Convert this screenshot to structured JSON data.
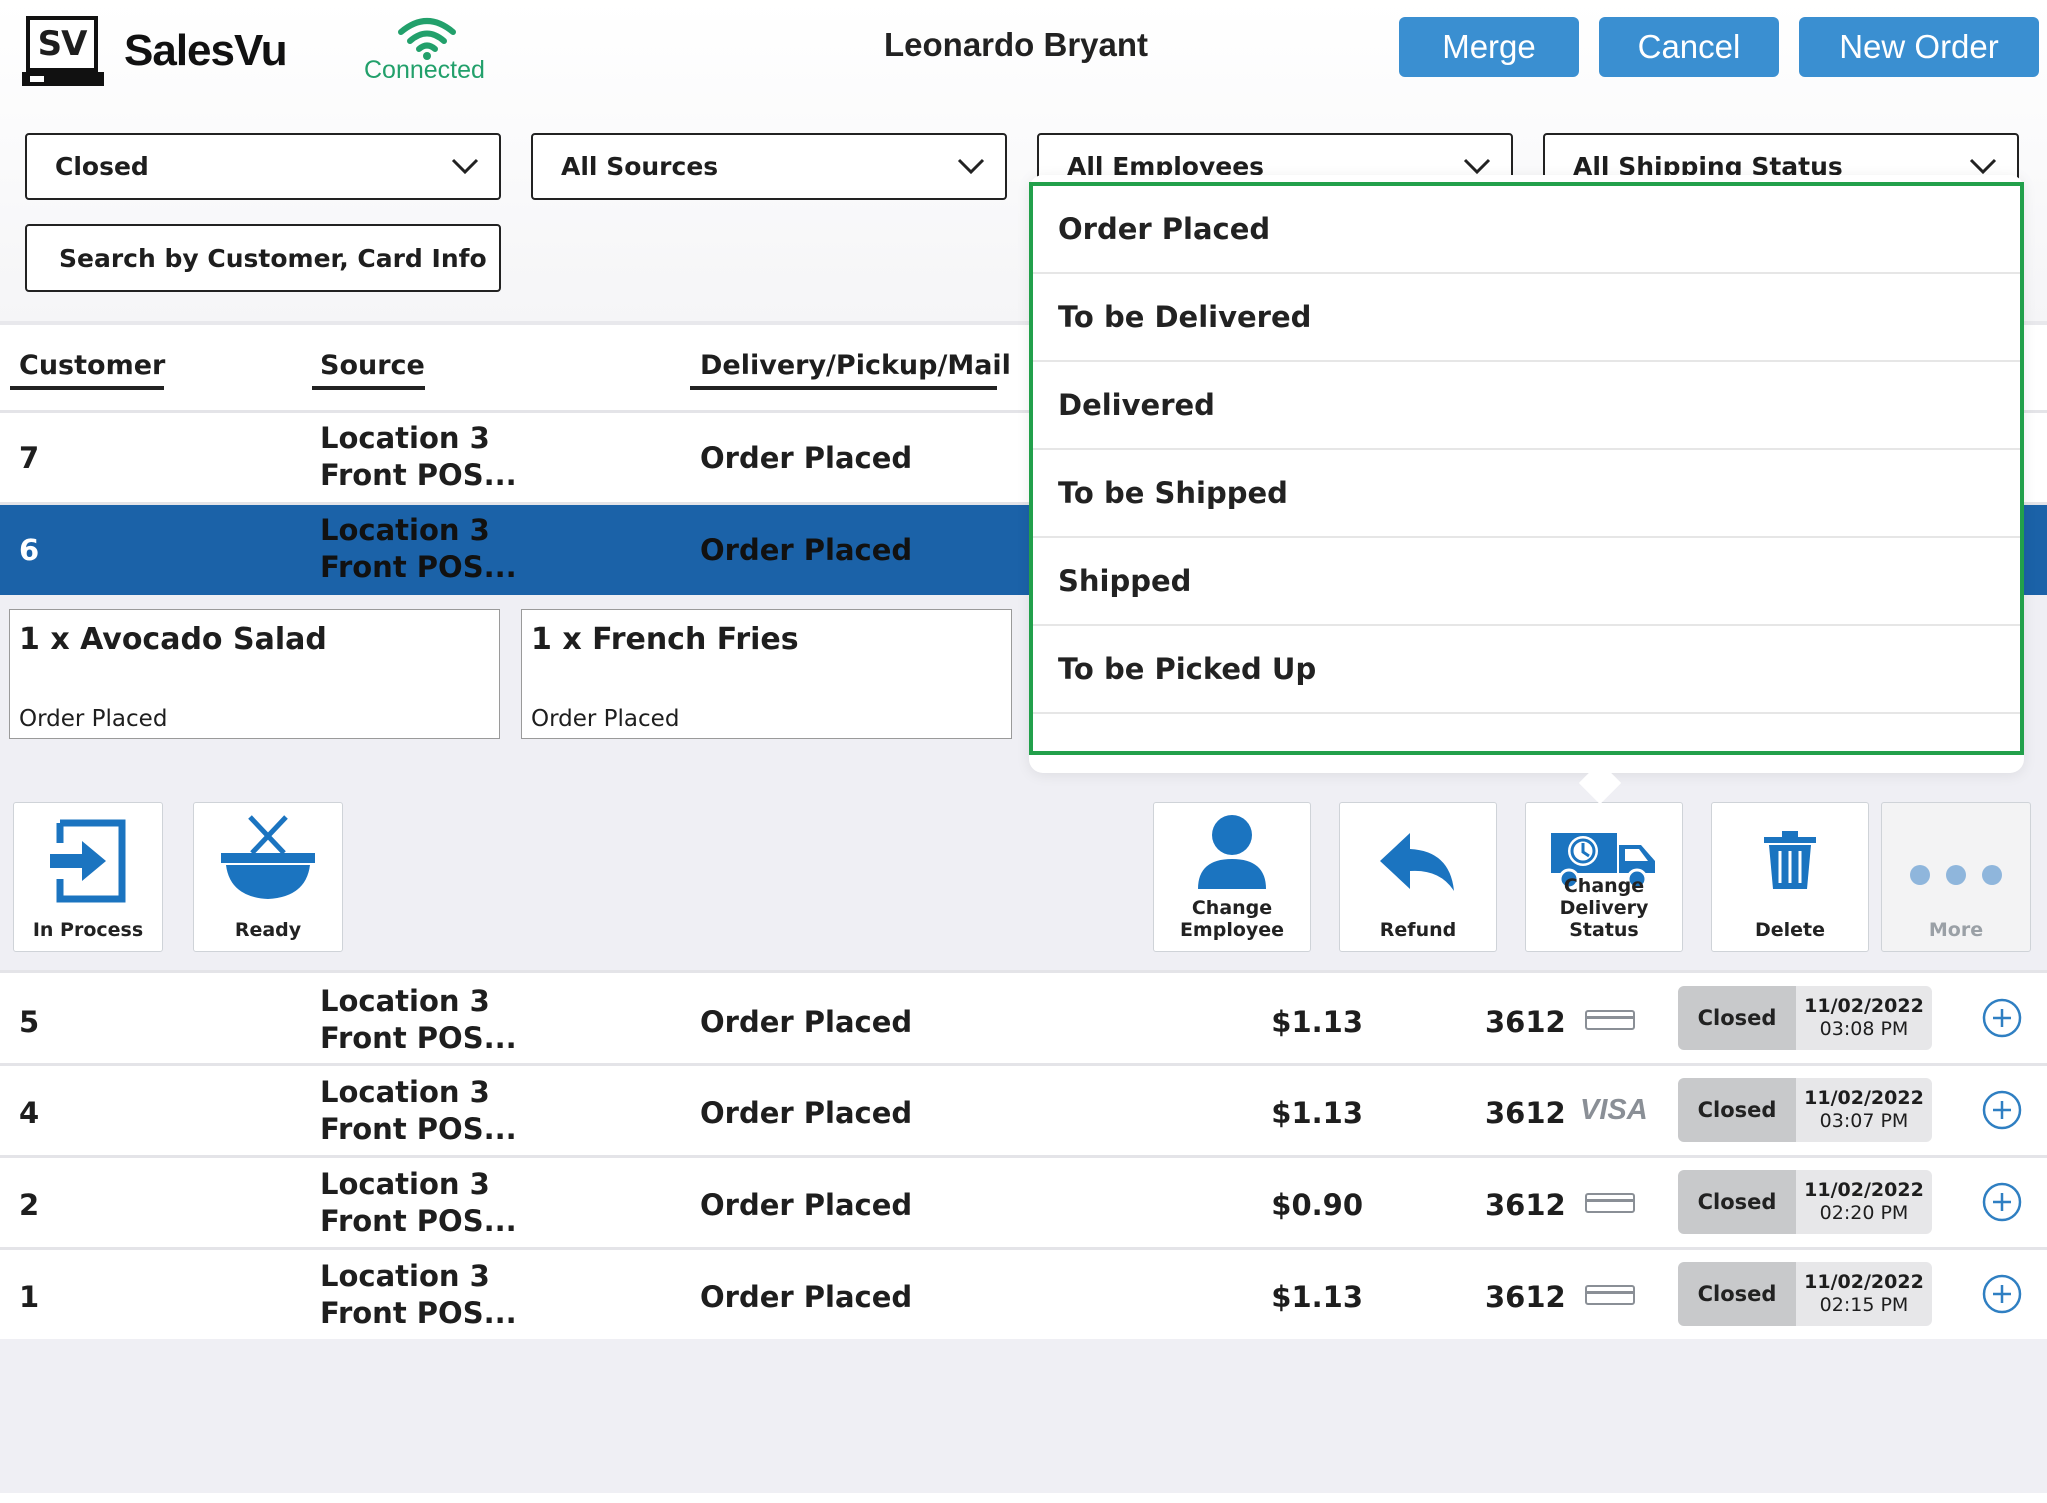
{
  "header": {
    "logo_text": "SV",
    "brand": "SalesVu",
    "connection_status": "Connected",
    "user_name": "Leonardo Bryant",
    "buttons": {
      "merge": "Merge",
      "cancel": "Cancel",
      "new_order": "New Order"
    }
  },
  "filters": {
    "status": "Closed",
    "sources": "All Sources",
    "employees": "All Employees",
    "shipping": "All Shipping Status",
    "search_label": "Search by Customer, Card Info"
  },
  "table": {
    "columns": [
      "Customer",
      "Source",
      "Delivery/Pickup/Mail"
    ],
    "rows_top": [
      {
        "customer": "7",
        "source_line1": "Location 3",
        "source_line2": "Front POS...",
        "status": "Order Placed"
      },
      {
        "customer": "6",
        "source_line1": "Location 3",
        "source_line2": "Front POS...",
        "status": "Order Placed",
        "selected": true
      }
    ],
    "items": [
      {
        "title": "1 x Avocado Salad",
        "status": "Order Placed"
      },
      {
        "title": "1 x French Fries",
        "status": "Order Placed"
      }
    ],
    "rows_bottom": [
      {
        "customer": "5",
        "source_line1": "Location 3",
        "source_line2": "Front POS...",
        "status": "Order Placed",
        "amount": "$1.13",
        "card_last4": "3612",
        "card_type": "generic",
        "badge": "Closed",
        "date": "11/02/2022",
        "time": "03:08 PM"
      },
      {
        "customer": "4",
        "source_line1": "Location 3",
        "source_line2": "Front POS...",
        "status": "Order Placed",
        "amount": "$1.13",
        "card_last4": "3612",
        "card_type": "visa",
        "card_label": "VISA",
        "badge": "Closed",
        "date": "11/02/2022",
        "time": "03:07 PM"
      },
      {
        "customer": "2",
        "source_line1": "Location 3",
        "source_line2": "Front POS...",
        "status": "Order Placed",
        "amount": "$0.90",
        "card_last4": "3612",
        "card_type": "generic",
        "badge": "Closed",
        "date": "11/02/2022",
        "time": "02:20 PM"
      },
      {
        "customer": "1",
        "source_line1": "Location 3",
        "source_line2": "Front POS...",
        "status": "Order Placed",
        "amount": "$1.13",
        "card_last4": "3612",
        "card_type": "generic",
        "badge": "Closed",
        "date": "11/02/2022",
        "time": "02:15 PM"
      }
    ]
  },
  "actions": {
    "in_process": "In Process",
    "ready": "Ready",
    "change_employee_1": "Change",
    "change_employee_2": "Employee",
    "refund": "Refund",
    "change_delivery_1": "Change",
    "change_delivery_2": "Delivery Status",
    "delete": "Delete",
    "more": "More"
  },
  "dropdown": {
    "options": [
      "Order Placed",
      "To be Delivered",
      "Delivered",
      "To be Shipped",
      "Shipped",
      "To be Picked Up"
    ]
  },
  "colors": {
    "accent": "#3a8fd1",
    "selected_row": "#1b62a8",
    "connected_green": "#22a06b",
    "dropdown_border": "#22a04b",
    "icon_blue": "#1b74c0"
  }
}
